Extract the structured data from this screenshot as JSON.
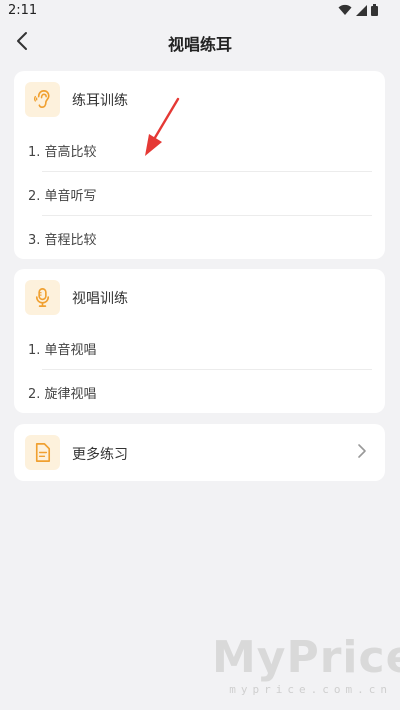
{
  "status_bar": {
    "time": "2:11"
  },
  "header": {
    "title": "视唱练耳"
  },
  "sections": [
    {
      "title": "练耳训练",
      "icon": "ear-icon",
      "items": [
        "1. 音高比较",
        "2. 单音听写",
        "3. 音程比较"
      ]
    },
    {
      "title": "视唱训练",
      "icon": "microphone-icon",
      "items": [
        "1. 单音视唱",
        "2. 旋律视唱"
      ]
    },
    {
      "title": "更多练习",
      "icon": "document-icon"
    }
  ],
  "colors": {
    "accent": "#f0a030",
    "icon_bg": "#fdf1dc",
    "annotation_arrow": "#e53935"
  },
  "watermark": {
    "brand": "MyPrice",
    "url": "myprice.com.cn"
  }
}
